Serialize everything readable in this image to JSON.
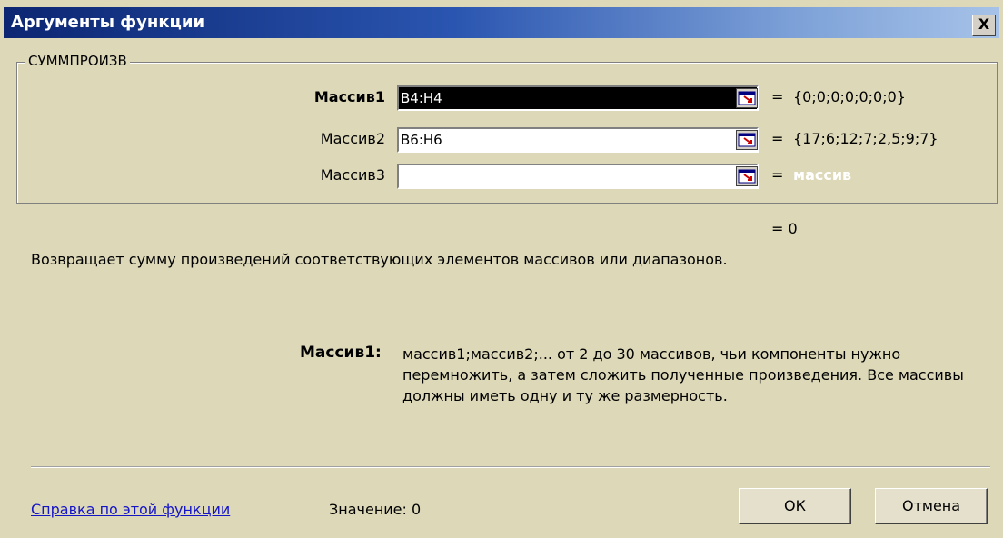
{
  "window": {
    "title": "Аргументы функции",
    "close_label": "X"
  },
  "function_name": "СУММПРОИЗВ",
  "arguments": [
    {
      "label": "Массив1",
      "value": "B4:H4",
      "result": "{0;0;0;0;0;0;0}"
    },
    {
      "label": "Массив2",
      "value": "B6:H6",
      "result": "{17;6;12;7;2,5;9;7}"
    },
    {
      "label": "Массив3",
      "value": "",
      "result": "массив"
    }
  ],
  "equals_sign": "=",
  "formula_result": "= 0",
  "description": "Возвращает сумму произведений соответствующих элементов массивов или диапазонов.",
  "help": {
    "label": "Массив1:",
    "text": "массив1;массив2;... от 2 до 30 массивов, чьи компоненты нужно перемножить, а затем сложить полученные произведения. Все массивы должны иметь одну и ту же размерность."
  },
  "footer": {
    "help_link": "Справка по этой функции",
    "value_label": "Значение: 0",
    "ok_label": "ОК",
    "cancel_label": "Отмена"
  },
  "colors": {
    "titlebar_start": "#0c2672",
    "dialog_bg": "#dcd8b8",
    "link": "#1515c8"
  }
}
